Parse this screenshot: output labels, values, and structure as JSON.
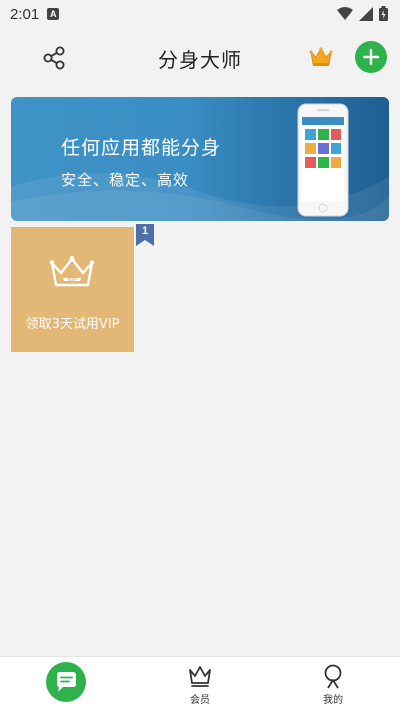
{
  "status": {
    "time": "2:01",
    "notification_icon": "a-notification-icon",
    "icons": [
      "wifi-icon",
      "signal-icon",
      "battery-icon"
    ]
  },
  "header": {
    "title": "分身大师",
    "left_icon": "share-icon",
    "right_icons": [
      "crown-icon",
      "add-icon"
    ],
    "accent_color": "#2fb24c"
  },
  "banner": {
    "title": "任何应用都能分身",
    "subtitle": "安全、稳定、高效",
    "colors": [
      "#3f93c6",
      "#1f5f93"
    ]
  },
  "apps": [
    {
      "label": "领取3天试用VIP",
      "icon": "vip-crown-icon",
      "badge": "1",
      "color": "#e3b776"
    }
  ],
  "bottom_nav": {
    "items": [
      {
        "label": "",
        "icon": "chat-icon",
        "active": true
      },
      {
        "label": "会员",
        "icon": "crown-outline-icon"
      },
      {
        "label": "我的",
        "icon": "user-icon"
      }
    ]
  }
}
